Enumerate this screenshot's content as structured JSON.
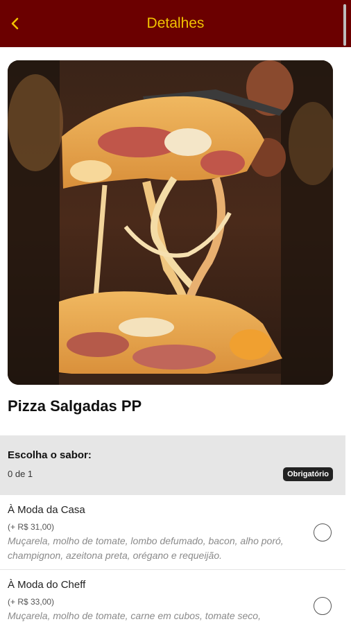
{
  "header": {
    "title": "Detalhes",
    "back_icon": "chevron-left-icon",
    "background": "#6b0000",
    "title_color": "#f2c200"
  },
  "product": {
    "image": "pizza-photo",
    "title": "Pizza Salgadas PP"
  },
  "section": {
    "title": "Escolha o sabor:",
    "count": "0 de 1",
    "badge": "Obrigatório"
  },
  "options": [
    {
      "name": "À Moda da Casa",
      "price": "(+ R$ 31,00)",
      "description": "Muçarela, molho de tomate, lombo defumado, bacon, alho poró, champignon, azeitona preta, orégano e requeijão."
    },
    {
      "name": "À Moda do Cheff",
      "price": "(+ R$ 33,00)",
      "description": "Muçarela, molho de tomate, carne em cubos, tomate seco,"
    }
  ]
}
